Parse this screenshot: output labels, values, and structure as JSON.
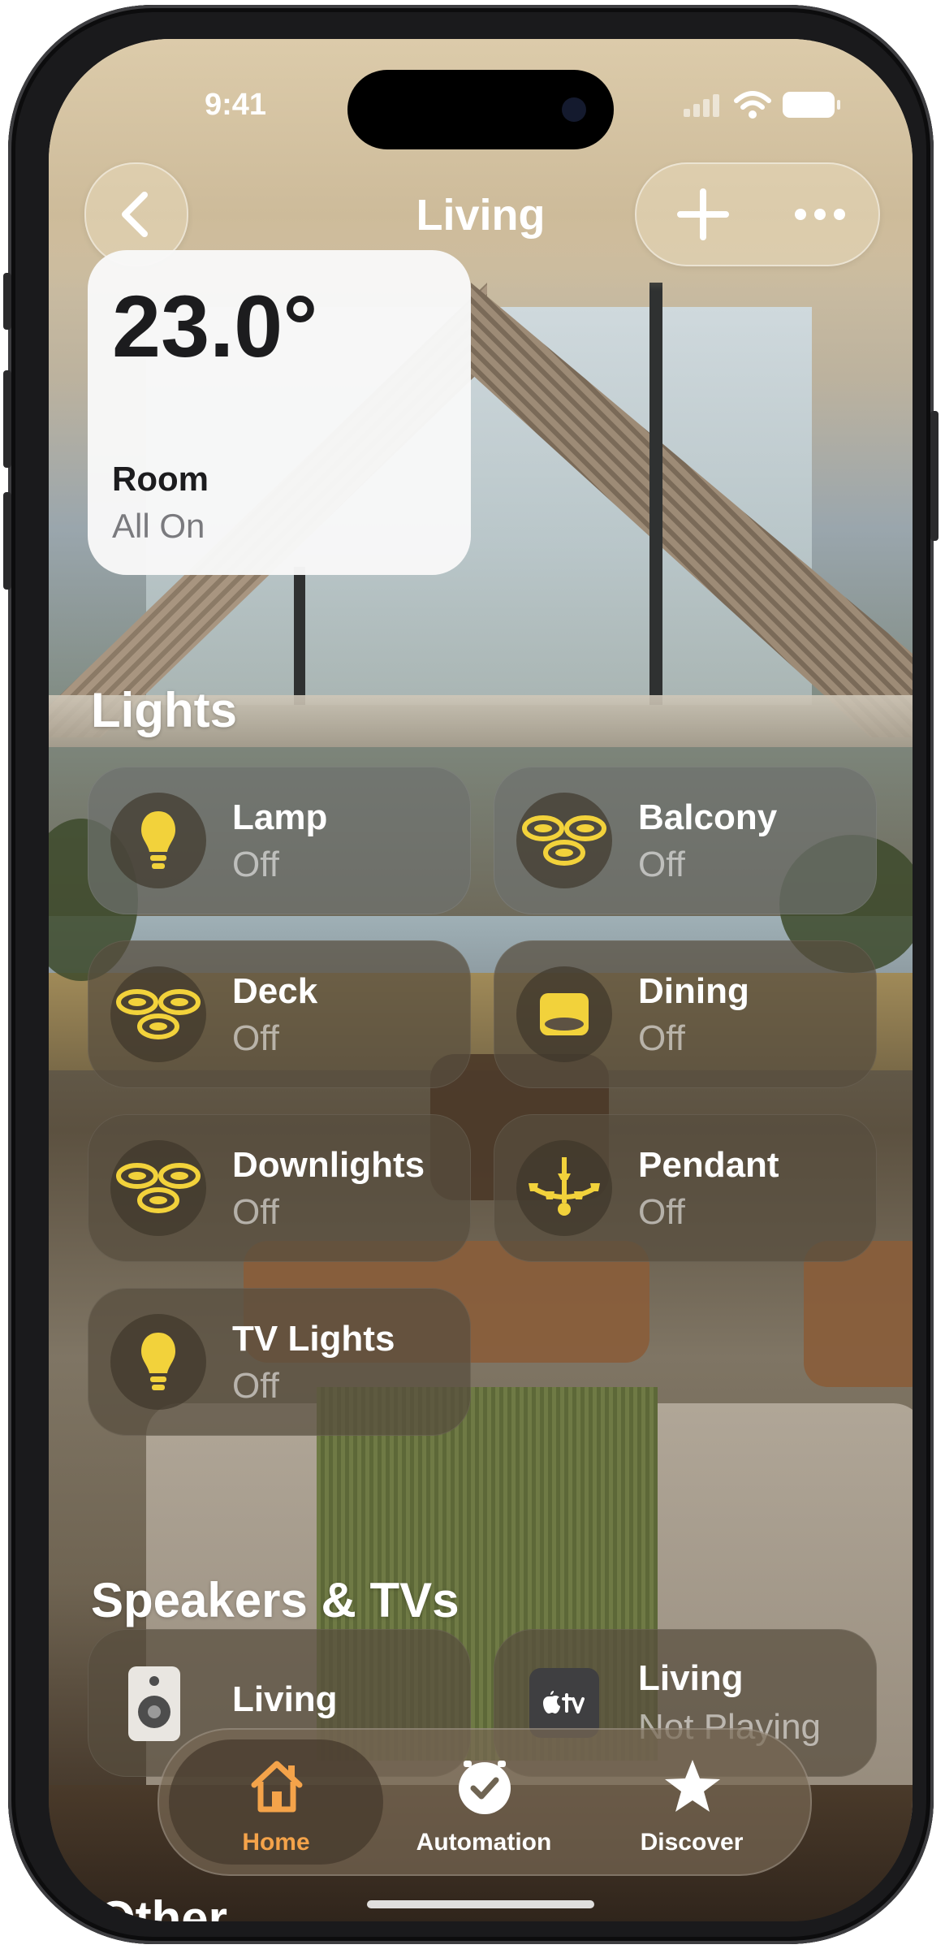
{
  "status_bar": {
    "time": "9:41"
  },
  "nav": {
    "title": "Living"
  },
  "climate": {
    "temperature": "23.0°",
    "label": "Room",
    "status": "All On"
  },
  "lights": {
    "title": "Lights",
    "items": [
      {
        "name": "Lamp",
        "status": "Off",
        "icon": "bulb-icon"
      },
      {
        "name": "Balcony",
        "status": "Off",
        "icon": "downlights-icon"
      },
      {
        "name": "Deck",
        "status": "Off",
        "icon": "downlights-icon"
      },
      {
        "name": "Dining",
        "status": "Off",
        "icon": "ceiling-light-icon"
      },
      {
        "name": "Downlights",
        "status": "Off",
        "icon": "downlights-icon"
      },
      {
        "name": "Pendant",
        "status": "Off",
        "icon": "chandelier-icon"
      },
      {
        "name": "TV Lights",
        "status": "Off",
        "icon": "bulb-icon"
      }
    ]
  },
  "speakers": {
    "title": "Speakers & TVs",
    "items": [
      {
        "name": "Living",
        "status": "",
        "icon": "speaker-icon"
      },
      {
        "name": "Living",
        "status": "Not Playing",
        "icon": "apple-tv-icon"
      }
    ]
  },
  "tabbar": {
    "tabs": [
      {
        "label": "Home",
        "icon": "home-icon",
        "selected": true
      },
      {
        "label": "Automation",
        "icon": "automation-icon",
        "selected": false
      },
      {
        "label": "Discover",
        "icon": "star-icon",
        "selected": false
      }
    ]
  },
  "other": {
    "title": "Other"
  },
  "colors": {
    "accent": "#f4a34a",
    "light_icon": "#f2d23b",
    "tile_text": "#ffffff"
  }
}
